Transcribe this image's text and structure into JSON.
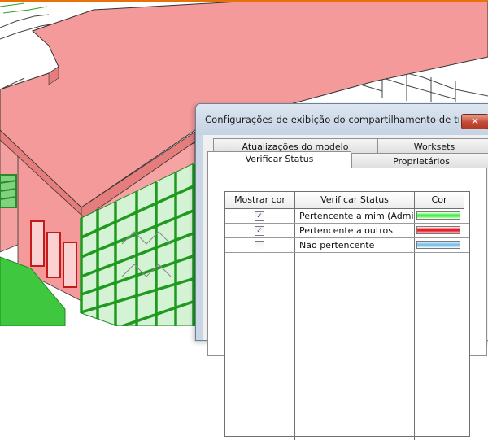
{
  "dialog": {
    "title": "Configurações de exibição do compartilhamento de trab...",
    "close_label": "✕",
    "tabs": [
      {
        "label": "Atualizações do modelo"
      },
      {
        "label": "Worksets"
      },
      {
        "label": "Verificar Status",
        "active": true
      },
      {
        "label": "Proprietários"
      }
    ]
  },
  "table": {
    "headers": {
      "show": "Mostrar cor",
      "status": "Verificar Status",
      "color": "Cor"
    },
    "rows": [
      {
        "checked": true,
        "checkmark": "✓",
        "status": "Pertencente a mim (Admi",
        "color": "#46f046"
      },
      {
        "checked": true,
        "checkmark": "✓",
        "status": "Pertencente a outros",
        "color": "#e8202a"
      },
      {
        "checked": false,
        "checkmark": "",
        "status": "Não pertencente",
        "color": "#7ec3ea"
      }
    ]
  },
  "colors": {
    "accent_orange": "#e8710a",
    "owned_by_others": "#f49a9a",
    "owned_by_me": "#3fc73f"
  }
}
